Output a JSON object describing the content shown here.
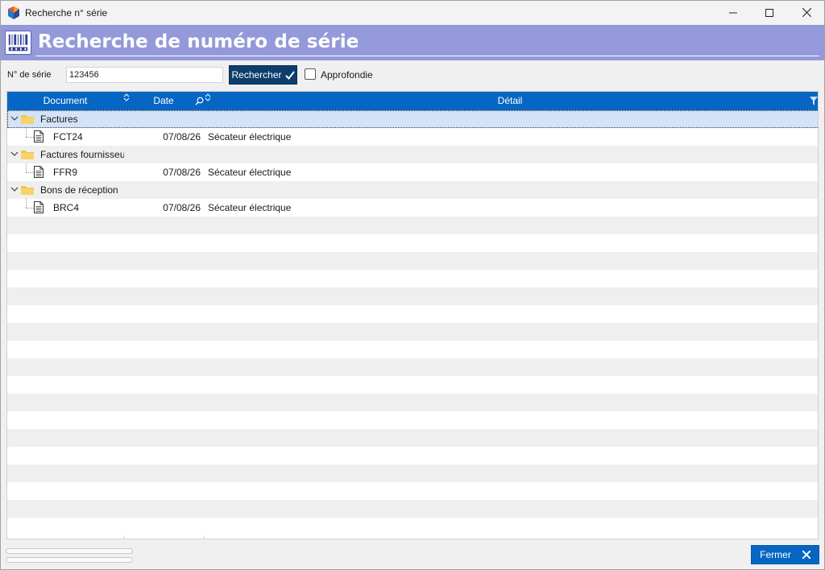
{
  "window": {
    "title": "Recherche n° série",
    "icons": {
      "app": "app-logo-icon",
      "minimize": "minimize-icon",
      "maximize": "maximize-icon",
      "close": "close-icon"
    }
  },
  "banner": {
    "title": "Recherche de numéro de série",
    "icon": "barcode-icon"
  },
  "search": {
    "label": "N° de série",
    "value": "123456",
    "button_label": "Rechercher",
    "button_icon": "checkmark-icon",
    "deep_label": "Approfondie",
    "deep_checked": false
  },
  "grid": {
    "columns": [
      {
        "label": "Document",
        "icon": "sort-icon"
      },
      {
        "label": "Date",
        "icon": "search-icon"
      },
      {
        "label": "Détail",
        "icon": "filter-icon"
      }
    ],
    "groups": [
      {
        "label": "Factures",
        "expanded": true,
        "selected": true,
        "items": [
          {
            "document": "FCT24",
            "date": "07/08/26",
            "detail": "Sécateur électrique"
          }
        ]
      },
      {
        "label": "Factures fournisseu",
        "expanded": true,
        "selected": false,
        "items": [
          {
            "document": "FFR9",
            "date": "07/08/26",
            "detail": "Sécateur électrique"
          }
        ]
      },
      {
        "label": "Bons de réception",
        "expanded": true,
        "selected": false,
        "items": [
          {
            "document": "BRC4",
            "date": "07/08/26",
            "detail": "Sécateur électrique"
          }
        ]
      }
    ]
  },
  "footer": {
    "close_label": "Fermer",
    "close_icon": "close-x-icon"
  },
  "colors": {
    "banner": "#9399d9",
    "grid_header": "#0766c4",
    "search_button": "#0d3d6b",
    "close_button": "#0766c4",
    "selected_row": "#cfe0f7",
    "folder": "#f5c542"
  }
}
